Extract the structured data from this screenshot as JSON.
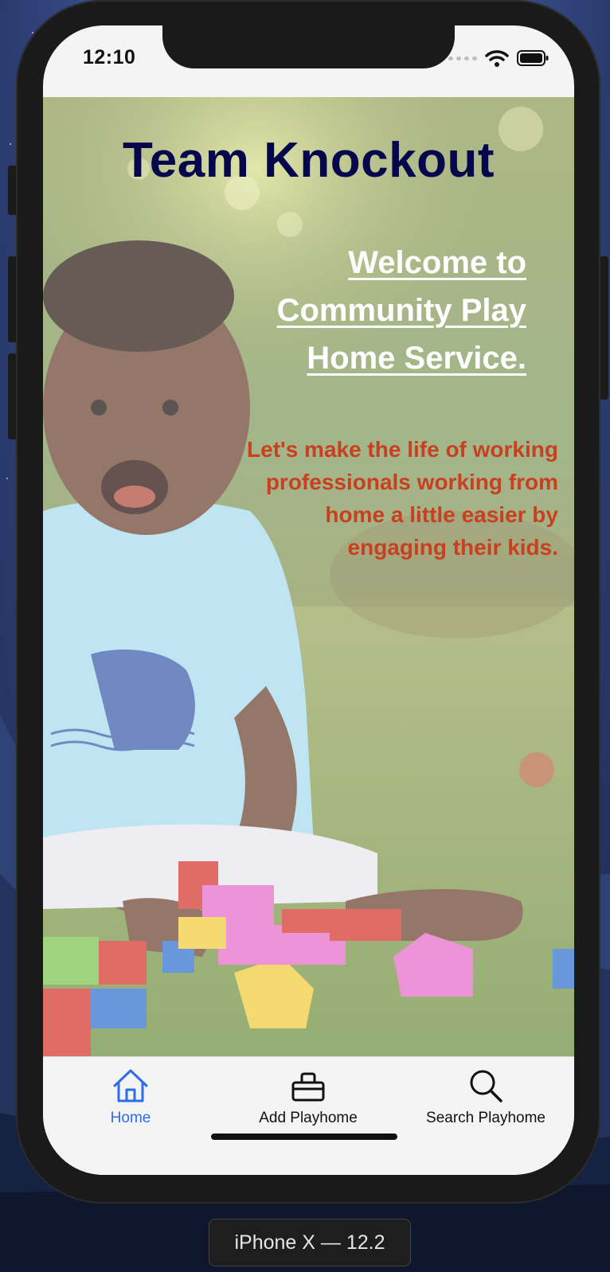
{
  "device": {
    "label": "iPhone X — 12.2"
  },
  "status_bar": {
    "time": "12:10"
  },
  "hero": {
    "title": "Team Knockout",
    "welcome": "Welcome to Community Play Home Service.",
    "tagline": "Let's make the life of working professionals working from home a little easier by engaging their kids."
  },
  "tabs": [
    {
      "label": "Home",
      "icon": "home-icon",
      "active": true
    },
    {
      "label": "Add Playhome",
      "icon": "basket-icon",
      "active": false
    },
    {
      "label": "Search Playhome",
      "icon": "search-icon",
      "active": false
    }
  ],
  "colors": {
    "title": "#06064d",
    "welcome": "#ffffff",
    "tagline": "#c8401f",
    "active_tab": "#2b6ee8"
  }
}
